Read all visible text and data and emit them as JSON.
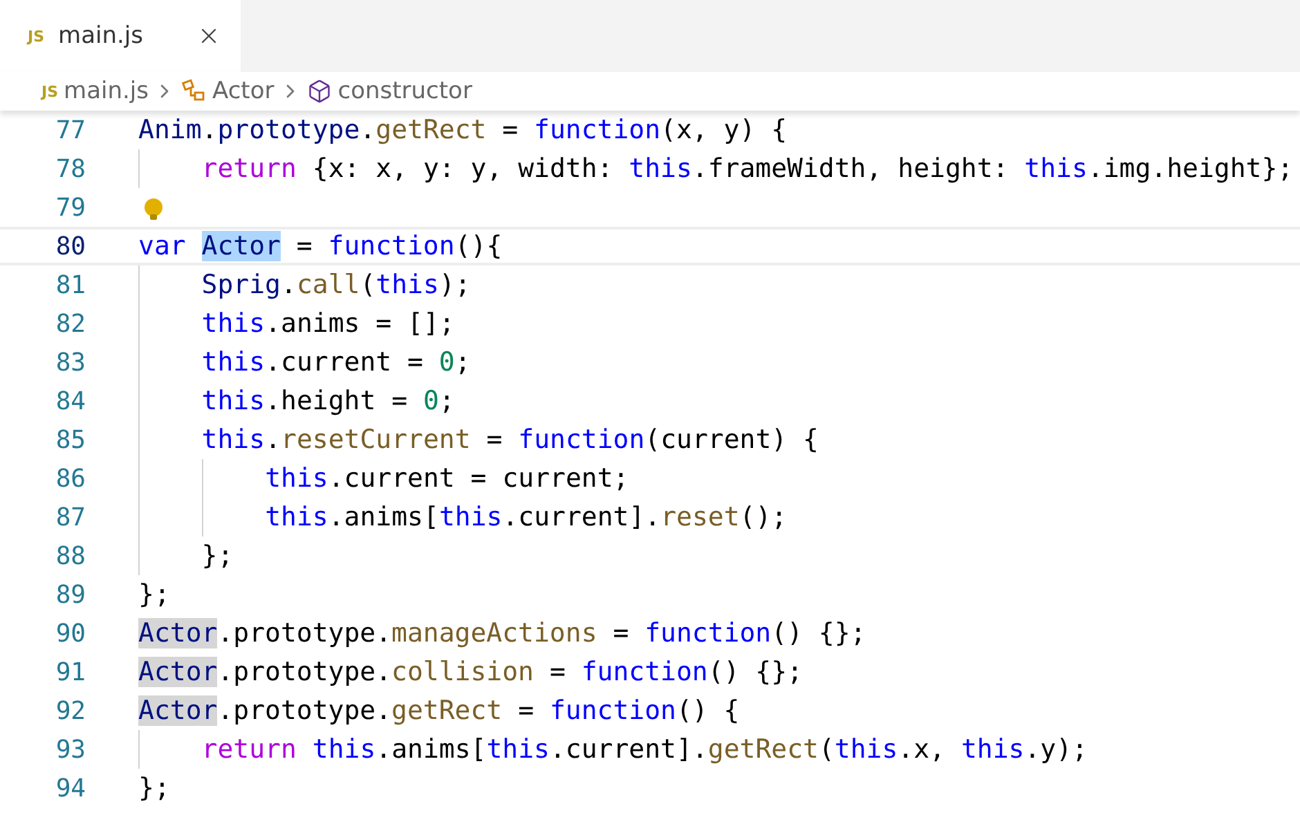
{
  "tab": {
    "badge": "JS",
    "label": "main.js",
    "selected": true
  },
  "breadcrumb": [
    {
      "kind": "file",
      "badge": "JS",
      "label": "main.js"
    },
    {
      "kind": "class",
      "label": "Actor"
    },
    {
      "kind": "method",
      "label": "constructor"
    }
  ],
  "lines": [
    {
      "number": "77",
      "current": false,
      "tokens": [
        {
          "kind": "var",
          "text": "Anim"
        },
        {
          "kind": "plain",
          "text": "."
        },
        {
          "kind": "var",
          "text": "prototype"
        },
        {
          "kind": "plain",
          "text": "."
        },
        {
          "kind": "fn",
          "text": "getRect"
        },
        {
          "kind": "plain",
          "text": " = "
        },
        {
          "kind": "kw",
          "text": "function"
        },
        {
          "kind": "plain",
          "text": "(x, y) {"
        }
      ],
      "children": [
        {
          "number": "78",
          "current": false,
          "tokens": [
            {
              "kind": "ctrl",
              "text": "return"
            },
            {
              "kind": "plain",
              "text": " {x: x, y: y, width: "
            },
            {
              "kind": "kw",
              "text": "this"
            },
            {
              "kind": "plain",
              "text": ".frameWidth, height: "
            },
            {
              "kind": "kw",
              "text": "this"
            },
            {
              "kind": "plain",
              "text": ".img.height};"
            }
          ]
        }
      ]
    },
    {
      "number": "79",
      "current": false,
      "bulb": true
    },
    {
      "number": "80",
      "current": true,
      "tokens": [
        {
          "kind": "kw",
          "text": "var "
        },
        {
          "kind": "var",
          "text": "Actor",
          "selected": true
        },
        {
          "kind": "plain",
          "text": " = "
        },
        {
          "kind": "kw",
          "text": "function"
        },
        {
          "kind": "plain",
          "text": "(){"
        }
      ],
      "children": [
        {
          "number": "81",
          "current": false,
          "tokens": [
            {
              "kind": "var",
              "text": "Sprig"
            },
            {
              "kind": "plain",
              "text": "."
            },
            {
              "kind": "fn",
              "text": "call"
            },
            {
              "kind": "plain",
              "text": "("
            },
            {
              "kind": "kw",
              "text": "this"
            },
            {
              "kind": "plain",
              "text": ");"
            }
          ]
        },
        {
          "number": "82",
          "current": false,
          "tokens": [
            {
              "kind": "kw",
              "text": "this"
            },
            {
              "kind": "plain",
              "text": ".anims = [];"
            }
          ]
        },
        {
          "number": "83",
          "current": false,
          "tokens": [
            {
              "kind": "kw",
              "text": "this"
            },
            {
              "kind": "plain",
              "text": ".current = "
            },
            {
              "kind": "num",
              "text": "0"
            },
            {
              "kind": "plain",
              "text": ";"
            }
          ]
        },
        {
          "number": "84",
          "current": false,
          "tokens": [
            {
              "kind": "kw",
              "text": "this"
            },
            {
              "kind": "plain",
              "text": ".height = "
            },
            {
              "kind": "num",
              "text": "0"
            },
            {
              "kind": "plain",
              "text": ";"
            }
          ]
        },
        {
          "number": "85",
          "current": false,
          "tokens": [
            {
              "kind": "kw",
              "text": "this"
            },
            {
              "kind": "plain",
              "text": "."
            },
            {
              "kind": "fn",
              "text": "resetCurrent"
            },
            {
              "kind": "plain",
              "text": " = "
            },
            {
              "kind": "kw",
              "text": "function"
            },
            {
              "kind": "plain",
              "text": "(current) {"
            }
          ],
          "children": [
            {
              "number": "86",
              "current": false,
              "tokens": [
                {
                  "kind": "kw",
                  "text": "this"
                },
                {
                  "kind": "plain",
                  "text": ".current = current;"
                }
              ]
            },
            {
              "number": "87",
              "current": false,
              "tokens": [
                {
                  "kind": "kw",
                  "text": "this"
                },
                {
                  "kind": "plain",
                  "text": ".anims["
                },
                {
                  "kind": "kw",
                  "text": "this"
                },
                {
                  "kind": "plain",
                  "text": ".current]."
                },
                {
                  "kind": "fn",
                  "text": "reset"
                },
                {
                  "kind": "plain",
                  "text": "();"
                }
              ]
            }
          ]
        },
        {
          "number": "88",
          "current": false,
          "tokens": [
            {
              "kind": "plain",
              "text": "};"
            }
          ]
        }
      ]
    },
    {
      "number": "89",
      "current": false,
      "tokens": [
        {
          "kind": "plain",
          "text": "};"
        }
      ]
    },
    {
      "number": "90",
      "current": false,
      "tokens": [
        {
          "kind": "var",
          "text": "Actor",
          "highlighted": true
        },
        {
          "kind": "plain",
          "text": ".prototype."
        },
        {
          "kind": "fn",
          "text": "manageActions"
        },
        {
          "kind": "plain",
          "text": " = "
        },
        {
          "kind": "kw",
          "text": "function"
        },
        {
          "kind": "plain",
          "text": "() {};"
        }
      ]
    },
    {
      "number": "91",
      "current": false,
      "tokens": [
        {
          "kind": "var",
          "text": "Actor",
          "highlighted": true
        },
        {
          "kind": "plain",
          "text": ".prototype."
        },
        {
          "kind": "fn",
          "text": "collision"
        },
        {
          "kind": "plain",
          "text": " = "
        },
        {
          "kind": "kw",
          "text": "function"
        },
        {
          "kind": "plain",
          "text": "() {};"
        }
      ]
    },
    {
      "number": "92",
      "current": false,
      "tokens": [
        {
          "kind": "var",
          "text": "Actor",
          "highlighted": true
        },
        {
          "kind": "plain",
          "text": ".prototype."
        },
        {
          "kind": "fn",
          "text": "getRect"
        },
        {
          "kind": "plain",
          "text": " = "
        },
        {
          "kind": "kw",
          "text": "function"
        },
        {
          "kind": "plain",
          "text": "() {"
        }
      ],
      "children": [
        {
          "number": "93",
          "current": false,
          "tokens": [
            {
              "kind": "ctrl",
              "text": "return "
            },
            {
              "kind": "kw",
              "text": "this"
            },
            {
              "kind": "plain",
              "text": ".anims["
            },
            {
              "kind": "kw",
              "text": "this"
            },
            {
              "kind": "plain",
              "text": ".current]."
            },
            {
              "kind": "fn",
              "text": "getRect"
            },
            {
              "kind": "plain",
              "text": "("
            },
            {
              "kind": "kw",
              "text": "this"
            },
            {
              "kind": "plain",
              "text": ".x, "
            },
            {
              "kind": "kw",
              "text": "this"
            },
            {
              "kind": "plain",
              "text": ".y);"
            }
          ]
        }
      ]
    },
    {
      "number": "94",
      "current": false,
      "tokens": [
        {
          "kind": "plain",
          "text": "};"
        }
      ]
    }
  ]
}
